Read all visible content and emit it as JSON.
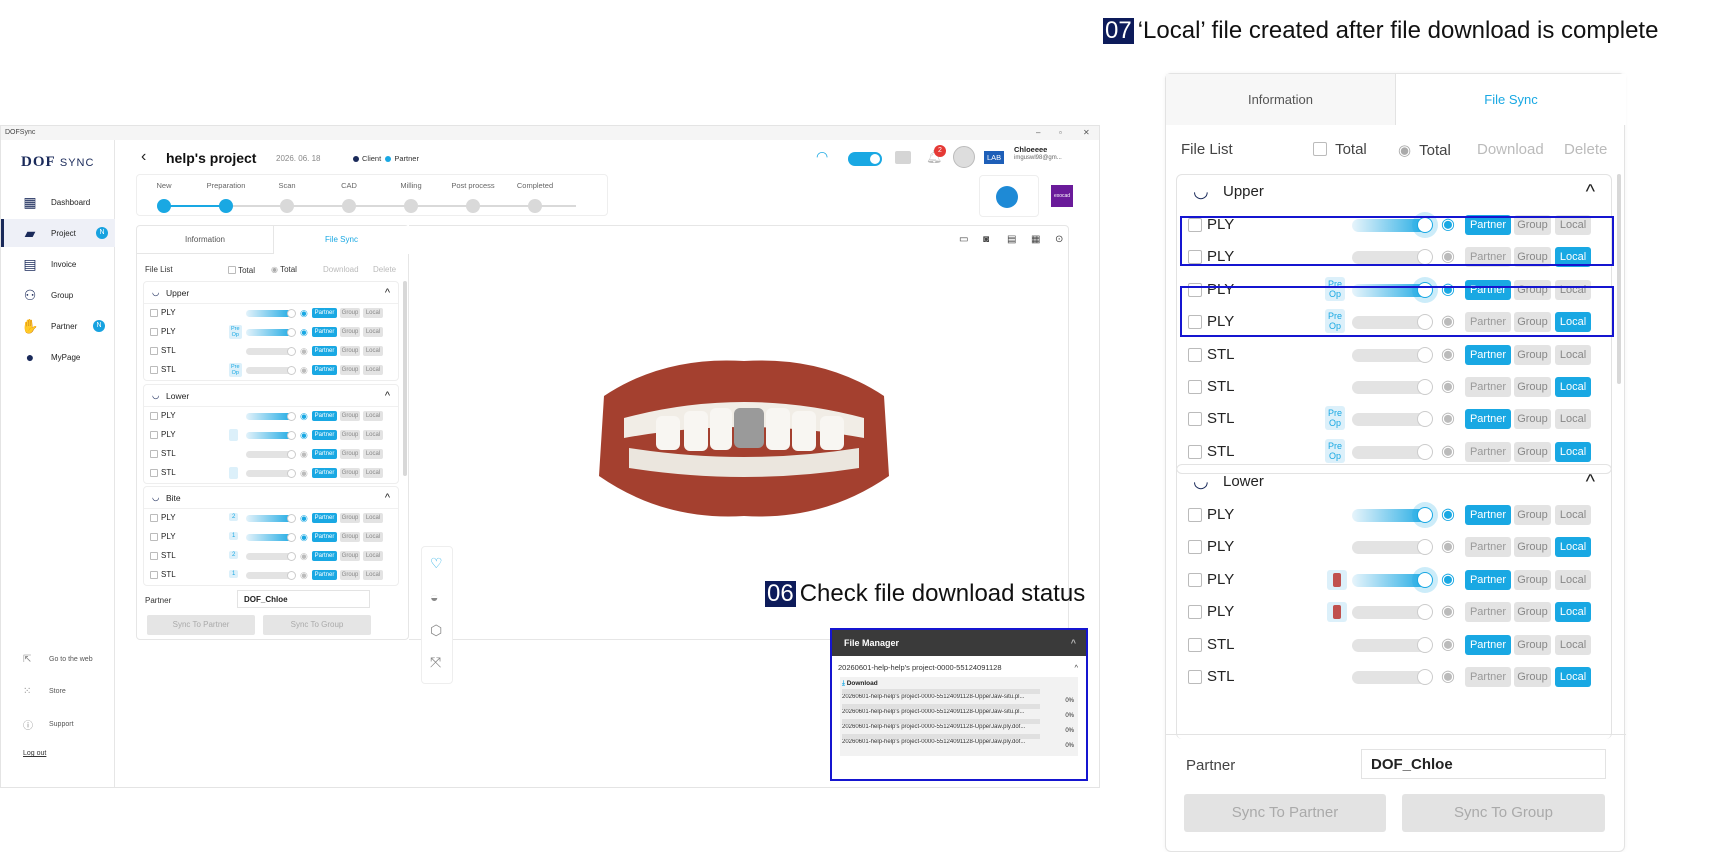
{
  "annotations": {
    "a07": {
      "num": "07",
      "text": "‘Local’ file created after file download is complete"
    },
    "a06": {
      "num": "06",
      "text": "Check file download status"
    }
  },
  "app": {
    "window_title": "DOFSync",
    "logo": {
      "main": "DOF",
      "sub": "SYNC"
    },
    "nav": [
      {
        "label": "Dashboard",
        "icon": "dashboard-icon"
      },
      {
        "label": "Project",
        "icon": "project-icon",
        "badge": "N",
        "active": true
      },
      {
        "label": "Invoice",
        "icon": "invoice-icon"
      },
      {
        "label": "Group",
        "icon": "group-icon"
      },
      {
        "label": "Partner",
        "icon": "partner-icon",
        "badge": "N"
      },
      {
        "label": "MyPage",
        "icon": "user-icon"
      }
    ],
    "bottom_nav": [
      "Go to the web",
      "Store",
      "Support"
    ],
    "logout": "Log out",
    "header": {
      "title": "help's project",
      "date": "2026. 06. 18",
      "legend_client": "Client",
      "legend_partner": "Partner",
      "notification_count": "2",
      "role_badge": "LAB",
      "user_name": "Chloeeee",
      "user_email": "imguswl98@gm..."
    },
    "steps": [
      "New",
      "Preparation",
      "Scan",
      "CAD",
      "Milling",
      "Post process",
      "Completed"
    ],
    "panel": {
      "tabs": [
        "Information",
        "File Sync"
      ],
      "file_list": "File List",
      "total1": "Total",
      "total2": "Total",
      "download": "Download",
      "delete": "Delete",
      "groups": [
        {
          "name": "Upper",
          "rows": [
            {
              "type": "PLY",
              "on": true,
              "tag": ""
            },
            {
              "type": "PLY",
              "on": true,
              "tag": "Pre Op"
            },
            {
              "type": "STL",
              "on": false,
              "tag": ""
            },
            {
              "type": "STL",
              "on": false,
              "tag": "Pre Op"
            }
          ]
        },
        {
          "name": "Lower",
          "rows": [
            {
              "type": "PLY",
              "on": true,
              "tag": ""
            },
            {
              "type": "PLY",
              "on": true,
              "tag": "icon"
            },
            {
              "type": "STL",
              "on": false,
              "tag": ""
            },
            {
              "type": "STL",
              "on": false,
              "tag": "icon"
            }
          ]
        },
        {
          "name": "Bite",
          "rows": [
            {
              "type": "PLY",
              "on": true,
              "tag": "2"
            },
            {
              "type": "PLY",
              "on": true,
              "tag": "1"
            },
            {
              "type": "STL",
              "on": false,
              "tag": "2"
            },
            {
              "type": "STL",
              "on": false,
              "tag": "1"
            }
          ]
        }
      ],
      "partner_label": "Partner",
      "partner_value": "DOF_Chloe",
      "sync_partner": "Sync To Partner",
      "sync_group": "Sync To Group",
      "pill_partner": "Partner",
      "pill_group": "Group",
      "pill_local": "Local"
    },
    "file_manager": {
      "title": "File Manager",
      "project": "20260601-help-help's project-0000-55124091128",
      "download": "Download",
      "files": [
        {
          "name": "20260601-help-help's project-0000-55124091128-UpperJaw-situ.pl...",
          "progress": "0%"
        },
        {
          "name": "20260601-help-help's project-0000-55124091128-UpperJaw-situ.pl...",
          "progress": "0%"
        },
        {
          "name": "20260601-help-help's project-0000-55124091128-UpperJaw.ply.dof...",
          "progress": "0%"
        },
        {
          "name": "20260601-help-help's project-0000-55124091128-UpperJaw.ply.dof...",
          "progress": "0%"
        }
      ]
    }
  },
  "big_panel": {
    "tabs": [
      "Information",
      "File Sync"
    ],
    "file_list": "File List",
    "total1": "Total",
    "total2": "Total",
    "download": "Download",
    "delete": "Delete",
    "upper": {
      "name": "Upper",
      "rows": [
        {
          "type": "PLY",
          "on": true,
          "tag": "",
          "partner": true,
          "local": false
        },
        {
          "type": "PLY",
          "on": false,
          "tag": "",
          "partner": false,
          "local": true
        },
        {
          "type": "PLY",
          "on": true,
          "tag": "Pre Op",
          "partner": true,
          "local": false
        },
        {
          "type": "PLY",
          "on": false,
          "tag": "Pre Op",
          "partner": false,
          "local": true
        },
        {
          "type": "STL",
          "on": false,
          "tag": "",
          "partner": true,
          "local": false
        },
        {
          "type": "STL",
          "on": false,
          "tag": "",
          "partner": false,
          "local": true
        },
        {
          "type": "STL",
          "on": false,
          "tag": "Pre Op",
          "partner": true,
          "local": false
        },
        {
          "type": "STL",
          "on": false,
          "tag": "Pre Op",
          "partner": false,
          "local": true
        }
      ]
    },
    "lower": {
      "name": "Lower",
      "rows": [
        {
          "type": "PLY",
          "on": true,
          "tag": "",
          "partner": true,
          "local": false
        },
        {
          "type": "PLY",
          "on": false,
          "tag": "",
          "partner": false,
          "local": true
        },
        {
          "type": "PLY",
          "on": true,
          "tag": "icon",
          "partner": true,
          "local": false
        },
        {
          "type": "PLY",
          "on": false,
          "tag": "icon",
          "partner": false,
          "local": true
        },
        {
          "type": "STL",
          "on": false,
          "tag": "",
          "partner": true,
          "local": false
        },
        {
          "type": "STL",
          "on": false,
          "tag": "",
          "partner": false,
          "local": true
        }
      ]
    },
    "pill_partner": "Partner",
    "pill_group": "Group",
    "pill_local": "Local",
    "partner_label": "Partner",
    "partner_value": "DOF_Chloe",
    "sync_partner": "Sync To Partner",
    "sync_group": "Sync To Group"
  }
}
